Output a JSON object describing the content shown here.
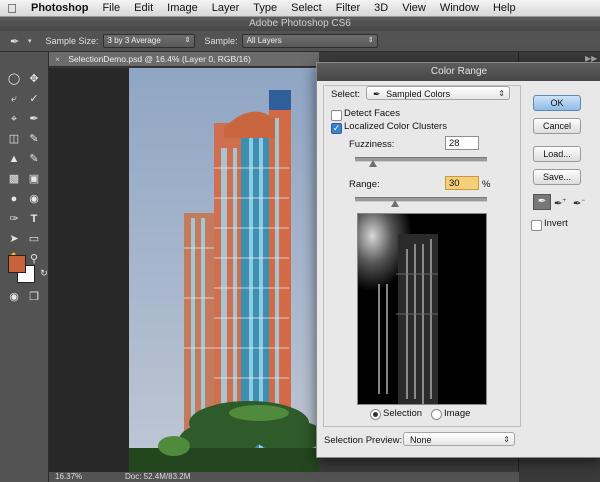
{
  "menubar": {
    "apple_icon": "apple-icon",
    "items": [
      "Photoshop",
      "File",
      "Edit",
      "Image",
      "Layer",
      "Type",
      "Select",
      "Filter",
      "3D",
      "View",
      "Window",
      "Help"
    ]
  },
  "app_title": "Adobe Photoshop CS6",
  "options_bar": {
    "tool_icon": "eyedropper-icon",
    "sample_size_label": "Sample Size:",
    "sample_size_value": "3 by 3 Average",
    "sample_label": "Sample:",
    "sample_value": "All Layers"
  },
  "toolbar": {
    "tools": [
      "marquee-icon",
      "move-icon",
      "lasso-icon",
      "quick-select-icon",
      "crop-icon",
      "eyedropper-icon",
      "healing-brush-icon",
      "brush-icon",
      "clone-stamp-icon",
      "history-brush-icon",
      "eraser-icon",
      "gradient-icon",
      "blur-icon",
      "dodge-icon",
      "pen-icon",
      "type-icon",
      "path-select-icon",
      "shape-icon",
      "hand-icon",
      "zoom-icon"
    ],
    "foreground_color": "#c8613e",
    "background_color": "#ffffff"
  },
  "document": {
    "tab_title": "SelectionDemo.psd @ 16.4% (Layer 0, RGB/16)",
    "close_label": "×"
  },
  "status": {
    "zoom": "16.37%",
    "doc_info": "Doc: 52.4M/83.2M"
  },
  "dialog": {
    "title": "Color Range",
    "select_label": "Select:",
    "select_value": "Sampled Colors",
    "detect_faces_label": "Detect Faces",
    "detect_faces_checked": false,
    "localized_label": "Localized Color Clusters",
    "localized_checked": true,
    "fuzziness_label": "Fuzziness:",
    "fuzziness_value": "28",
    "fuzziness_fraction": 0.14,
    "range_label": "Range:",
    "range_value": "30",
    "range_unit": "%",
    "range_fraction": 0.3,
    "radio_selection_label": "Selection",
    "radio_image_label": "Image",
    "radio_selected": "Selection",
    "preview_label": "Selection Preview:",
    "preview_value": "None",
    "buttons": {
      "ok": "OK",
      "cancel": "Cancel",
      "load": "Load...",
      "save": "Save..."
    },
    "invert_label": "Invert",
    "invert_checked": false,
    "eyedroppers": [
      "eyedropper-icon",
      "eyedropper-plus-icon",
      "eyedropper-minus-icon"
    ]
  }
}
